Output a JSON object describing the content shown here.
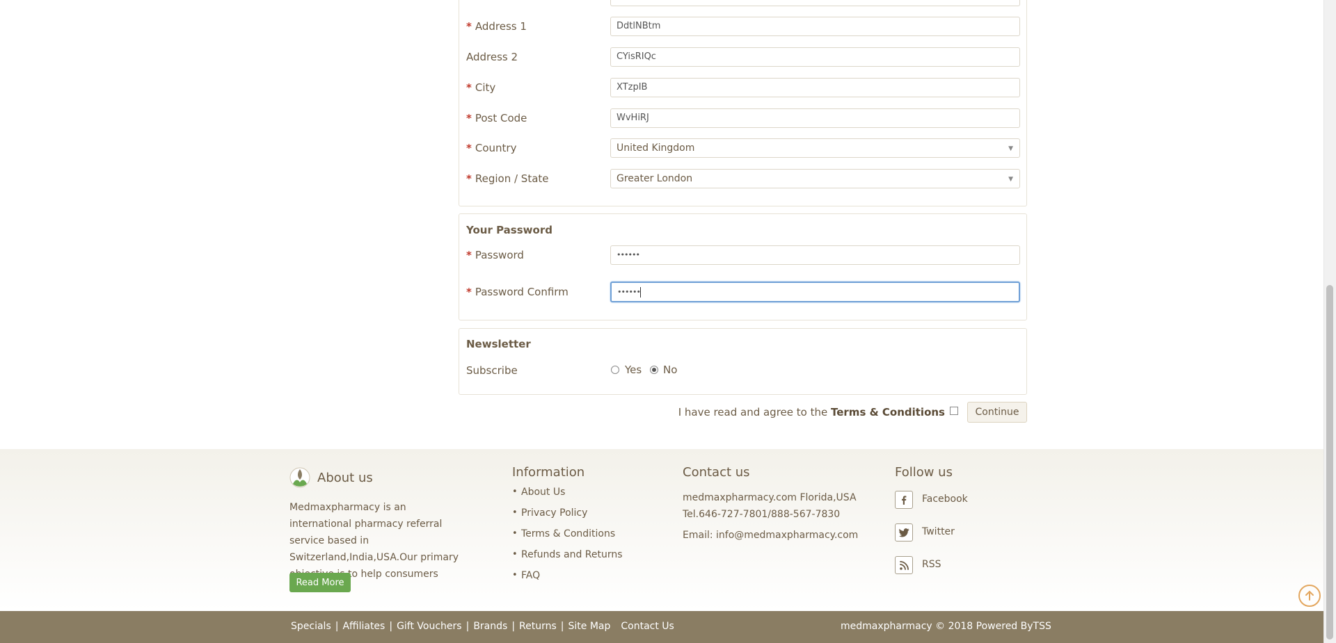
{
  "address": {
    "fields": [
      {
        "label": "Address 1",
        "required": true,
        "value": "DdtlNBtm"
      },
      {
        "label": "Address 2",
        "required": false,
        "value": "CYisRIQc"
      },
      {
        "label": "City",
        "required": true,
        "value": "XTzpIB"
      },
      {
        "label": "Post Code",
        "required": true,
        "value": "WvHiRJ"
      }
    ],
    "country": {
      "label": "Country",
      "value": "United Kingdom"
    },
    "region": {
      "label": "Region / State",
      "value": "Greater London"
    }
  },
  "password": {
    "title": "Your Password",
    "password_label": "Password",
    "password_value": "••••••",
    "confirm_label": "Password Confirm",
    "confirm_value": "••••••"
  },
  "newsletter": {
    "title": "Newsletter",
    "subscribe_label": "Subscribe",
    "yes_label": "Yes",
    "no_label": "No",
    "selected": "No"
  },
  "agree": {
    "text": "I have read and agree to the",
    "link": "Terms & Conditions",
    "continue_label": "Continue"
  },
  "footer": {
    "about": {
      "title": "About us",
      "text": "Medmaxpharmacy is an international pharmacy referral service based in Switzerland,India,USA.Our primary objective is to help consumers",
      "read_more": "Read More"
    },
    "information": {
      "title": "Information",
      "items": [
        "About Us",
        "Privacy Policy",
        "Terms & Conditions",
        "Refunds and Returns",
        "FAQ"
      ]
    },
    "contact": {
      "title": "Contact us",
      "address": "medmaxpharmacy.com Florida,USA",
      "tel": "Tel.646-727-7801/888-567-7830",
      "email": "Email: info@medmaxpharmacy.com"
    },
    "follow": {
      "title": "Follow us",
      "items": [
        "Facebook",
        "Twitter",
        "RSS"
      ]
    }
  },
  "bottom_bar": {
    "links": [
      "Specials",
      "Affiliates",
      "Gift Vouchers",
      "Brands",
      "Returns",
      "Site Map"
    ],
    "contact_link": "Contact Us",
    "copyright": "medmaxpharmacy © 2018 Powered ByTSS"
  },
  "colors": {
    "accent_green": "#6aa84f",
    "bottom_bar": "#8a7d63",
    "required": "#c0392b",
    "focus_border": "#6e9fd6"
  }
}
